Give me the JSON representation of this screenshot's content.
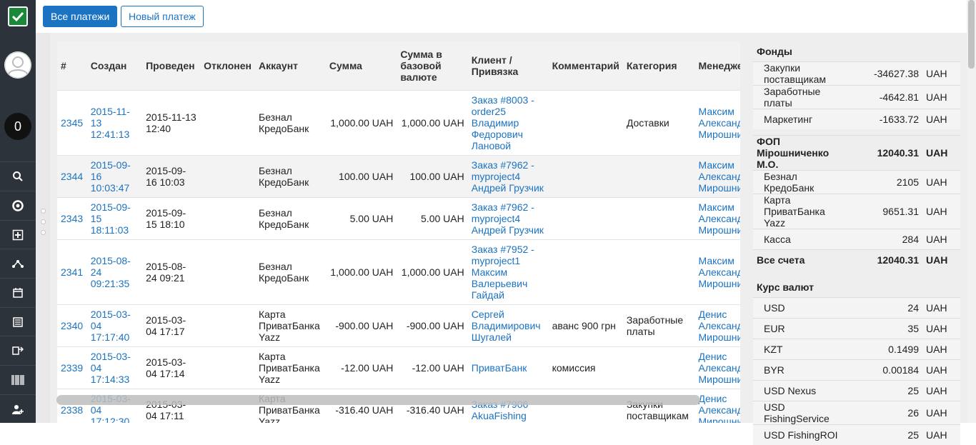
{
  "topbar": {
    "all_payments": "Все платежи",
    "new_payment": "Новый платеж"
  },
  "sidebar": {
    "counter": "0"
  },
  "table": {
    "headers": [
      "#",
      "Создан",
      "Проведен",
      "Отклонен",
      "Аккаунт",
      "Сумма",
      "Сумма в базовой валюте",
      "Клиент / Привязка",
      "Комментарий",
      "Категория",
      "Менеджер"
    ],
    "rows": [
      {
        "id": "2345",
        "created": "2015-11-13 12:41:13",
        "done": "2015-11-13 12:40",
        "rejected": "",
        "account": "Безнал КредоБанк",
        "sum": "1,000.00 UAH",
        "base": "1,000.00 UAH",
        "client": "Заказ #8003 - order25 Владимир Федорович Лановой",
        "comment": "",
        "category": "Доставки",
        "manager": "Максим Александрович Мирошниченко"
      },
      {
        "id": "2344",
        "created": "2015-09-16 10:03:47",
        "done": "2015-09-16 10:03",
        "rejected": "",
        "account": "Безнал КредоБанк",
        "sum": "100.00 UAH",
        "base": "100.00 UAH",
        "client": "Заказ #7962 - myproject4 Андрей Грузчик",
        "comment": "",
        "category": "",
        "manager": "Максим Александрович Мирошниченко"
      },
      {
        "id": "2343",
        "created": "2015-09-15 18:11:03",
        "done": "2015-09-15 18:10",
        "rejected": "",
        "account": "Безнал КредоБанк",
        "sum": "5.00 UAH",
        "base": "5.00 UAH",
        "client": "Заказ #7962 - myproject4 Андрей Грузчик",
        "comment": "",
        "category": "",
        "manager": "Максим Александрович Мирошниченко"
      },
      {
        "id": "2341",
        "created": "2015-08-24 09:21:35",
        "done": "2015-08-24 09:21",
        "rejected": "",
        "account": "Безнал КредоБанк",
        "sum": "1,000.00 UAH",
        "base": "1,000.00 UAH",
        "client": "Заказ #7952 - myproject1 Максим Валерьевич Гайдай",
        "comment": "",
        "category": "",
        "manager": "Максим Александрович Мирошниченко"
      },
      {
        "id": "2340",
        "created": "2015-03-04 17:17:40",
        "done": "2015-03-04 17:17",
        "rejected": "",
        "account": "Карта ПриватБанка Yazz",
        "sum": "-900.00 UAH",
        "base": "-900.00 UAH",
        "client": "Сергей Владимирович Шугалей",
        "comment": "аванс 900 грн",
        "category": "Заработные платы",
        "manager": "Денис Александрович Мирошниченко"
      },
      {
        "id": "2339",
        "created": "2015-03-04 17:14:33",
        "done": "2015-03-04 17:14",
        "rejected": "",
        "account": "Карта ПриватБанка Yazz",
        "sum": "-12.00 UAH",
        "base": "-12.00 UAH",
        "client": "ПриватБанк",
        "comment": "комиссия",
        "category": "",
        "manager": "Денис Александрович Мирошниченко"
      },
      {
        "id": "2338",
        "created": "2015-03-04 17:12:30",
        "done": "2015-03-04 17:11",
        "rejected": "",
        "account": "Карта ПриватБанка Yazz",
        "sum": "-316.40 UAH",
        "base": "-316.40 UAH",
        "client": "Заказ #7906 AkuaFishing",
        "comment": "",
        "category": "Закупки поставщикам",
        "manager": "Денис Александрович Мирошниченко"
      }
    ]
  },
  "funds": {
    "title": "Фонды",
    "items": [
      {
        "name": "Закупки поставщикам",
        "value": "-34627.38",
        "currency": "UAH"
      },
      {
        "name": "Заработные платы",
        "value": "-4642.81",
        "currency": "UAH"
      },
      {
        "name": "Маркетинг",
        "value": "-1633.72",
        "currency": "UAH"
      }
    ],
    "company": {
      "name": "ФОП Мірошниченко М.О.",
      "value": "12040.31",
      "currency": "UAH"
    },
    "accounts": [
      {
        "name": "Безнал КредоБанк",
        "value": "2105",
        "currency": "UAH"
      },
      {
        "name": "Карта ПриватБанка Yazz",
        "value": "9651.31",
        "currency": "UAH"
      },
      {
        "name": "Касса",
        "value": "284",
        "currency": "UAH"
      }
    ],
    "total": {
      "name": "Все счета",
      "value": "12040.31",
      "currency": "UAH"
    }
  },
  "rates": {
    "title": "Курс валют",
    "items": [
      {
        "name": "USD",
        "value": "24",
        "currency": "UAH"
      },
      {
        "name": "EUR",
        "value": "35",
        "currency": "UAH"
      },
      {
        "name": "KZT",
        "value": "0.1499",
        "currency": "UAH"
      },
      {
        "name": "BYR",
        "value": "0.00184",
        "currency": "UAH"
      },
      {
        "name": "USD Nexus",
        "value": "25",
        "currency": "UAH"
      },
      {
        "name": "USD FishingService",
        "value": "26",
        "currency": "UAH"
      },
      {
        "name": "USD FishingROI",
        "value": "25",
        "currency": "UAH"
      }
    ]
  }
}
